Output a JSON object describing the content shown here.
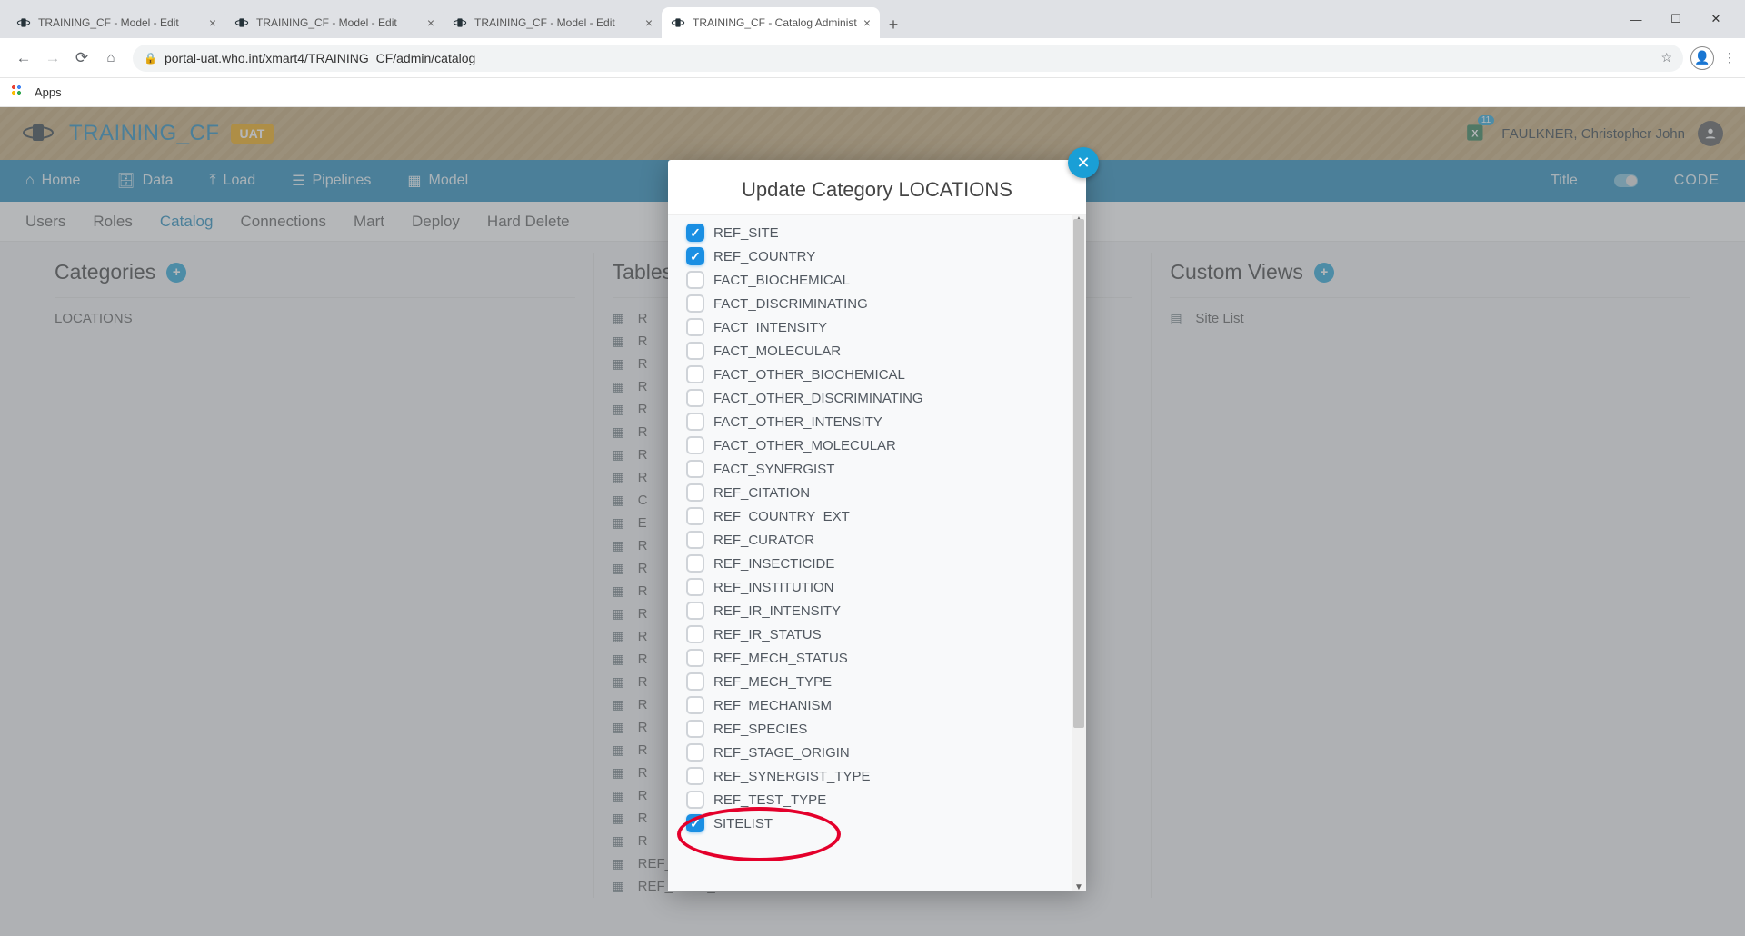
{
  "browser": {
    "tabs": [
      {
        "title": "TRAINING_CF - Model - Edit",
        "active": false
      },
      {
        "title": "TRAINING_CF - Model - Edit",
        "active": false
      },
      {
        "title": "TRAINING_CF - Model - Edit",
        "active": false
      },
      {
        "title": "TRAINING_CF - Catalog Administ",
        "active": true
      }
    ],
    "url": "portal-uat.who.int/xmart4/TRAINING_CF/admin/catalog",
    "bookmark_label": "Apps"
  },
  "header": {
    "title": "TRAINING_CF",
    "badge": "UAT",
    "user": "FAULKNER, Christopher John",
    "notif_count": "11"
  },
  "main_nav": {
    "items": [
      "Home",
      "Data",
      "Load",
      "Pipelines",
      "Model"
    ],
    "right_title_label": "Title",
    "right_code_label": "CODE"
  },
  "sub_nav": {
    "items": [
      {
        "label": "Users",
        "active": false
      },
      {
        "label": "Roles",
        "active": false
      },
      {
        "label": "Catalog",
        "active": true
      },
      {
        "label": "Connections",
        "active": false
      },
      {
        "label": "Mart",
        "active": false
      },
      {
        "label": "Deploy",
        "active": false
      },
      {
        "label": "Hard Delete",
        "active": false
      }
    ]
  },
  "columns": {
    "categories": {
      "title": "Categories",
      "items": [
        "LOCATIONS"
      ]
    },
    "tables": {
      "title": "Tables",
      "items": [
        "R",
        "R",
        "R",
        "R",
        "R",
        "R",
        "R",
        "R",
        "C",
        "E",
        "R",
        "R",
        "R",
        "R",
        "R",
        "R",
        "R",
        "R",
        "R",
        "R",
        "R",
        "R",
        "R",
        "R",
        "REF_SYNERGIST_TYPE",
        "REF_TEST_TYPE"
      ]
    },
    "custom_views": {
      "title": "Custom Views",
      "items": [
        "Site List"
      ]
    }
  },
  "modal": {
    "title": "Update Category LOCATIONS",
    "rows": [
      {
        "label": "REF_SITE",
        "checked": true
      },
      {
        "label": "REF_COUNTRY",
        "checked": true
      },
      {
        "label": "FACT_BIOCHEMICAL",
        "checked": false
      },
      {
        "label": "FACT_DISCRIMINATING",
        "checked": false
      },
      {
        "label": "FACT_INTENSITY",
        "checked": false
      },
      {
        "label": "FACT_MOLECULAR",
        "checked": false
      },
      {
        "label": "FACT_OTHER_BIOCHEMICAL",
        "checked": false
      },
      {
        "label": "FACT_OTHER_DISCRIMINATING",
        "checked": false
      },
      {
        "label": "FACT_OTHER_INTENSITY",
        "checked": false
      },
      {
        "label": "FACT_OTHER_MOLECULAR",
        "checked": false
      },
      {
        "label": "FACT_SYNERGIST",
        "checked": false
      },
      {
        "label": "REF_CITATION",
        "checked": false
      },
      {
        "label": "REF_COUNTRY_EXT",
        "checked": false
      },
      {
        "label": "REF_CURATOR",
        "checked": false
      },
      {
        "label": "REF_INSECTICIDE",
        "checked": false
      },
      {
        "label": "REF_INSTITUTION",
        "checked": false
      },
      {
        "label": "REF_IR_INTENSITY",
        "checked": false
      },
      {
        "label": "REF_IR_STATUS",
        "checked": false
      },
      {
        "label": "REF_MECH_STATUS",
        "checked": false
      },
      {
        "label": "REF_MECH_TYPE",
        "checked": false
      },
      {
        "label": "REF_MECHANISM",
        "checked": false
      },
      {
        "label": "REF_SPECIES",
        "checked": false
      },
      {
        "label": "REF_STAGE_ORIGIN",
        "checked": false
      },
      {
        "label": "REF_SYNERGIST_TYPE",
        "checked": false
      },
      {
        "label": "REF_TEST_TYPE",
        "checked": false
      },
      {
        "label": "SITELIST",
        "checked": true
      }
    ]
  }
}
